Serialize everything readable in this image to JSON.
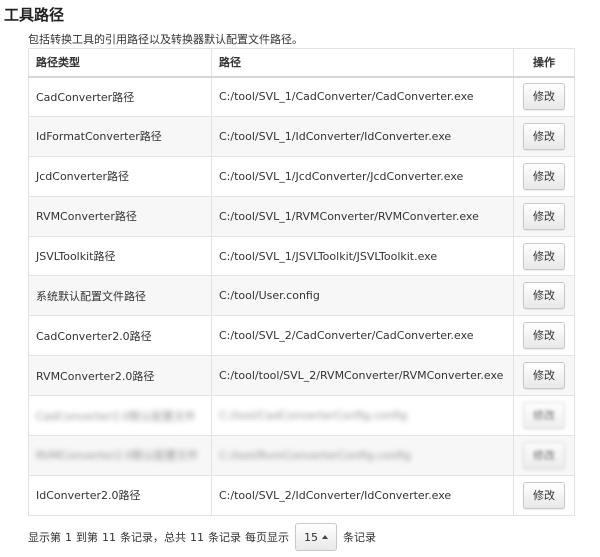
{
  "page": {
    "title": "工具路径",
    "subtitle": "包括转换工具的引用路径以及转换器默认配置文件路径。"
  },
  "table": {
    "headers": {
      "type": "路径类型",
      "path": "路径",
      "op": "操作"
    },
    "edit_label": "修改",
    "rows": [
      {
        "type": "CadConverter路径",
        "path": "C:/tool/SVL_1/CadConverter/CadConverter.exe",
        "blurred": false
      },
      {
        "type": "IdFormatConverter路径",
        "path": "C:/tool/SVL_1/IdConverter/IdConverter.exe",
        "blurred": false
      },
      {
        "type": "JcdConverter路径",
        "path": "C:/tool/SVL_1/JcdConverter/JcdConverter.exe",
        "blurred": false
      },
      {
        "type": "RVMConverter路径",
        "path": "C:/tool/SVL_1/RVMConverter/RVMConverter.exe",
        "blurred": false
      },
      {
        "type": "JSVLToolkit路径",
        "path": "C:/tool/SVL_1/JSVLToolkit/JSVLToolkit.exe",
        "blurred": false
      },
      {
        "type": "系统默认配置文件路径",
        "path": "C:/tool/User.config",
        "blurred": false
      },
      {
        "type": "CadConverter2.0路径",
        "path": "C:/tool/SVL_2/CadConverter/CadConverter.exe",
        "blurred": false
      },
      {
        "type": "RVMConverter2.0路径",
        "path": "C:/tool/tool/SVL_2/RVMConverter/RVMConverter.exe",
        "blurred": false
      },
      {
        "type": "CadConverter2.0默认配置文件",
        "path": "C:/tool/CadConverterConfig.config",
        "blurred": true
      },
      {
        "type": "RVMConverter2.0默认配置文件",
        "path": "C:/tool/RvmConverterConfig.config",
        "blurred": true
      },
      {
        "type": "IdConverter2.0路径",
        "path": "C:/tool/SVL_2/IdConverter/IdConverter.exe",
        "blurred": false
      }
    ]
  },
  "footer": {
    "showing_prefix": "显示第",
    "start": "1",
    "to_label": "到第",
    "end": "11",
    "records_label": "条记录，总共",
    "total": "11",
    "records_total_label": "条记录",
    "per_page_label": "每页显示",
    "page_size": "15",
    "page_size_suffix": "条记录"
  }
}
